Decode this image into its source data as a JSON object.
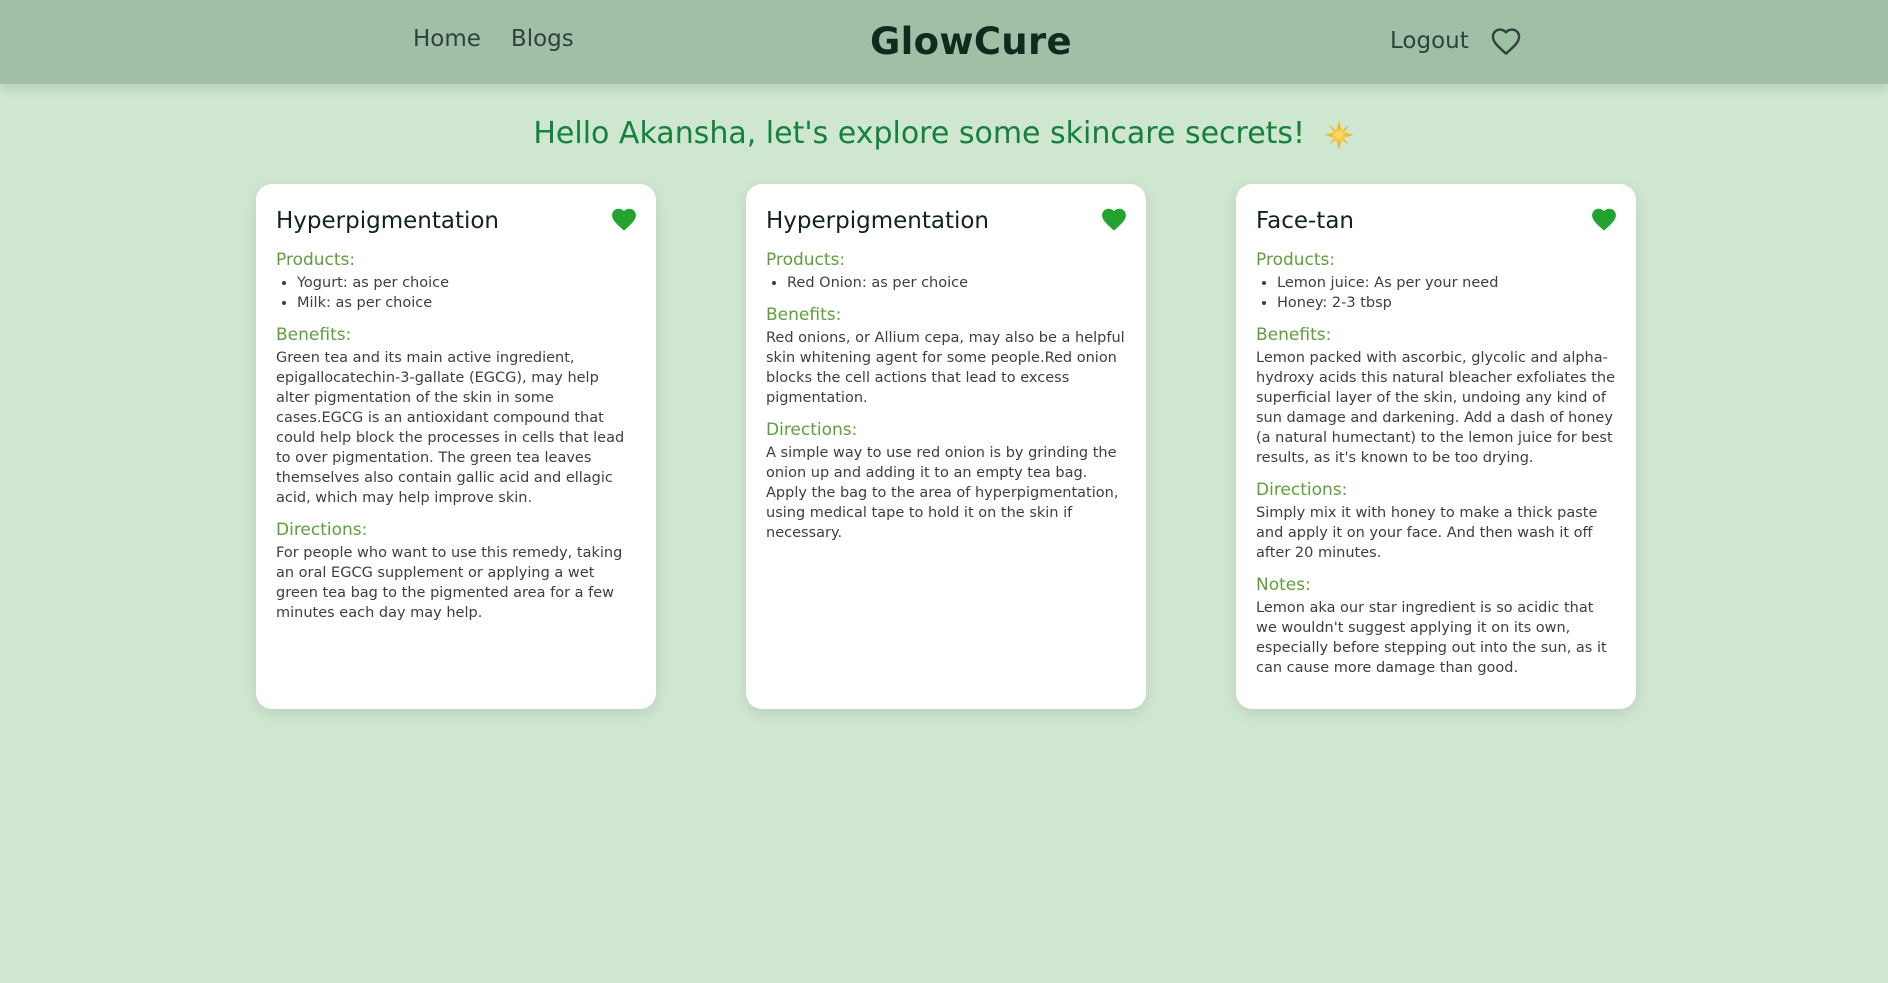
{
  "nav": {
    "home": "Home",
    "blogs": "Blogs",
    "brand": "GlowCure",
    "logout": "Logout",
    "favorites_icon": "heart-outline-icon"
  },
  "greeting": {
    "text": "Hello Akansha, let's explore some skincare secrets!",
    "emoji_icon": "sparkle-sun-emoji"
  },
  "colors": {
    "navbar_bg": "#a0bfa7",
    "page_bg": "#cfe6d1",
    "greeting_green": "#14823b",
    "label_green": "#5f9e3b",
    "heart_green": "#22a22e"
  },
  "labels": {
    "products": "Products:",
    "benefits": "Benefits:",
    "directions": "Directions:",
    "notes": "Notes:"
  },
  "cards": [
    {
      "title": "Hyperpigmentation",
      "favorite_icon": "heart-filled-icon",
      "products": [
        "Yogurt: as per choice",
        "Milk: as per choice"
      ],
      "benefits": "Green tea and its main active ingredient, epigallocatechin-3-gallate (EGCG), may help alter pigmentation of the skin in some cases.EGCG is an antioxidant compound that could help block the processes in cells that lead to over pigmentation. The green tea leaves themselves also contain gallic acid and ellagic acid, which may help improve skin.",
      "directions": "For people who want to use this remedy, taking an oral EGCG supplement or applying a wet green tea bag to the pigmented area for a few minutes each day may help."
    },
    {
      "title": "Hyperpigmentation",
      "favorite_icon": "heart-filled-icon",
      "products": [
        "Red Onion: as per choice"
      ],
      "benefits": "Red onions, or Allium cepa, may also be a helpful skin whitening agent for some people.Red onion blocks the cell actions that lead to excess pigmentation.",
      "directions": "A simple way to use red onion is by grinding the onion up and adding it to an empty tea bag. Apply the bag to the area of hyperpigmentation, using medical tape to hold it on the skin if necessary."
    },
    {
      "title": "Face-tan",
      "favorite_icon": "heart-filled-icon",
      "products": [
        "Lemon juice: As per your need",
        "Honey: 2-3 tbsp"
      ],
      "benefits": "Lemon packed with ascorbic, glycolic and alpha-hydroxy acids this natural bleacher exfoliates the superficial layer of the skin, undoing any kind of sun damage and darkening. Add a dash of honey (a natural humectant) to the lemon juice for best results, as it's known to be too drying.",
      "directions": "Simply mix it with honey to make a thick paste and apply it on your face. And then wash it off after 20 minutes.",
      "notes": "Lemon aka our star ingredient is so acidic that we wouldn't suggest applying it on its own, especially before stepping out into the sun, as it can cause more damage than good."
    }
  ]
}
